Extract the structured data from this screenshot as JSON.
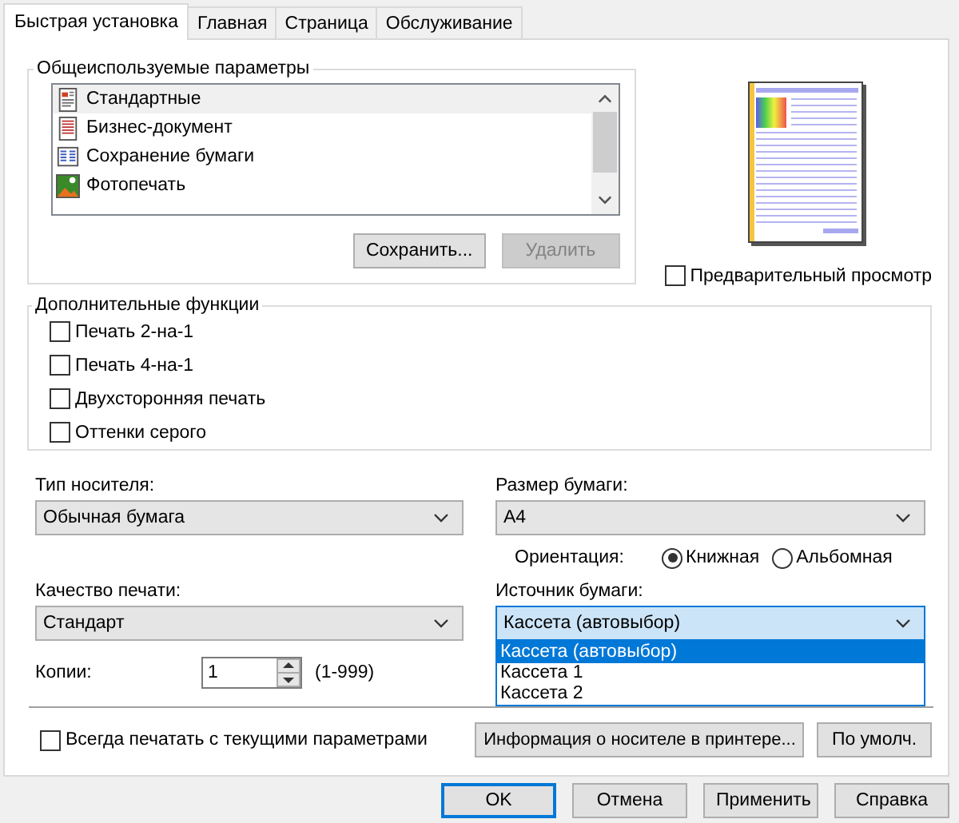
{
  "tabs": [
    {
      "label": "Быстрая установка",
      "selected": true
    },
    {
      "label": "Главная",
      "selected": false
    },
    {
      "label": "Страница",
      "selected": false
    },
    {
      "label": "Обслуживание",
      "selected": false
    }
  ],
  "presets": {
    "title": "Общеиспользуемые параметры",
    "items": [
      {
        "label": "Стандартные",
        "kind": "standard",
        "selected": true
      },
      {
        "label": "Бизнес-документ",
        "kind": "business",
        "selected": false
      },
      {
        "label": "Сохранение бумаги",
        "kind": "saving",
        "selected": false
      },
      {
        "label": "Фотопечать",
        "kind": "photo",
        "selected": false
      }
    ],
    "buttons": [
      {
        "label": "Сохранить...",
        "disabled": false
      },
      {
        "label": "Удалить",
        "disabled": true
      }
    ]
  },
  "preview": {
    "label": "Предварительный просмотр",
    "checked": false
  },
  "extra": {
    "title": "Дополнительные функции",
    "options": [
      {
        "label": "Печать 2-на-1",
        "checked": false
      },
      {
        "label": "Печать 4-на-1",
        "checked": false
      },
      {
        "label": "Двухсторонняя печать",
        "checked": false
      },
      {
        "label": "Оттенки серого",
        "checked": false
      }
    ]
  },
  "media_type": {
    "label": "Тип носителя:",
    "value": "Обычная бумага"
  },
  "paper_size": {
    "label": "Размер бумаги:",
    "value": "A4"
  },
  "orientation": {
    "label": "Ориентация:",
    "options": [
      {
        "label": "Книжная",
        "selected": true
      },
      {
        "label": "Альбомная",
        "selected": false
      }
    ]
  },
  "quality": {
    "label": "Качество печати:",
    "value": "Стандарт"
  },
  "source": {
    "label": "Источник бумаги:",
    "value": "Кассета (автовыбор)",
    "expanded": true,
    "options": [
      {
        "label": "Кассета (автовыбор)",
        "selected": true
      },
      {
        "label": "Кассета 1",
        "selected": false
      },
      {
        "label": "Кассета 2",
        "selected": false
      }
    ]
  },
  "copies": {
    "label": "Копии:",
    "value": "1",
    "range": "(1-999)"
  },
  "always": {
    "label": "Всегда печатать с текущими параметрами",
    "checked": false
  },
  "media_info_button": "Информация о носителе в принтере...",
  "defaults_button": "По умолч.",
  "buttons": [
    {
      "label": "OK",
      "default": true
    },
    {
      "label": "Отмена",
      "default": false
    },
    {
      "label": "Применить",
      "default": false
    },
    {
      "label": "Справка",
      "default": false
    }
  ]
}
